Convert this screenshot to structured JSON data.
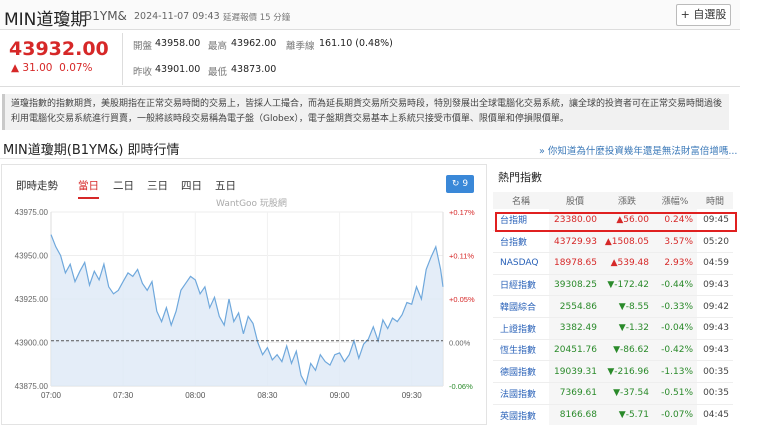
{
  "header": {
    "name": "MIN道瓊期",
    "code": "B1YM&",
    "datetime": "2024-11-07 09:43",
    "delay": "延遲報價 15 分鐘",
    "fav_button": "+ 自選股"
  },
  "quote": {
    "price": "43932.00",
    "change": "31.00",
    "change_pct": "0.07%",
    "open_label": "開盤",
    "open": "43958.00",
    "high_label": "最高",
    "high": "43962.00",
    "ma_label": "離季線",
    "ma": "161.10 (0.48%)",
    "prev_label": "昨收",
    "prev": "43901.00",
    "low_label": "最低",
    "low": "43873.00",
    "up_color": "#d62828"
  },
  "description": "道瓊指數的指數期貨，美股期指在正常交易時間的交易上，皆採人工撮合，而為延長期貨交易所交易時段，特別發展出全球電腦化交易系統，讓全球的投資者可在正常交易時間過後利用電腦化交易系統進行買賣，一般將該時段交易稱為電子盤（Globex），電子盤期貨交易基本上系統只接受市價單、限價單和停損限價單。",
  "section": {
    "title": "MIN道瓊期(B1YM&) 即時行情",
    "promo_link": "» 你知道為什麼投資幾年還是無法財富倍增嗎..."
  },
  "chart_panel": {
    "label": "即時走勢",
    "tabs": [
      "當日",
      "二日",
      "三日",
      "四日",
      "五日"
    ],
    "active_tab": "當日",
    "refresh_label": "9",
    "watermark": "WantGoo 玩股網"
  },
  "chart_data": {
    "type": "line",
    "title": "",
    "xlabel": "",
    "ylabel": "",
    "x_ticks": [
      "07:00",
      "07:30",
      "08:00",
      "08:30",
      "09:00",
      "09:30"
    ],
    "y_ticks": [
      "43975.00",
      "43950.00",
      "43925.00",
      "43900.00",
      "43875.00"
    ],
    "y_tick_values": [
      43975,
      43950,
      43925,
      43900,
      43875
    ],
    "y2_ticks": [
      "+0.17%",
      "+0.11%",
      "+0.05%",
      "0.00%",
      "-0.06%"
    ],
    "ylim": [
      43875,
      43975
    ],
    "xlim": [
      "07:00",
      "09:43"
    ],
    "reference_value": 43901,
    "line_color": "#6fa8dc",
    "fill_color": "#dde9f6",
    "series": [
      {
        "x": [
          "07:00",
          "07:02",
          "07:04",
          "07:06",
          "07:08",
          "07:10",
          "07:12",
          "07:14",
          "07:16",
          "07:18",
          "07:20",
          "07:22",
          "07:24",
          "07:26",
          "07:28",
          "07:30",
          "07:32",
          "07:34",
          "07:36",
          "07:38",
          "07:40",
          "07:42",
          "07:44",
          "07:46",
          "07:48",
          "07:50",
          "07:52",
          "07:54",
          "07:56",
          "07:58",
          "08:00",
          "08:02",
          "08:04",
          "08:06",
          "08:08",
          "08:10",
          "08:12",
          "08:14",
          "08:16",
          "08:18",
          "08:20",
          "08:22",
          "08:24",
          "08:26",
          "08:28",
          "08:30",
          "08:32",
          "08:34",
          "08:36",
          "08:38",
          "08:40",
          "08:42",
          "08:44",
          "08:46",
          "08:48",
          "08:50",
          "08:52",
          "08:54",
          "08:56",
          "08:58",
          "09:00",
          "09:02",
          "09:04",
          "09:06",
          "09:08",
          "09:10",
          "09:12",
          "09:14",
          "09:16",
          "09:18",
          "09:20",
          "09:22",
          "09:24",
          "09:26",
          "09:28",
          "09:30",
          "09:32",
          "09:34",
          "09:36",
          "09:38",
          "09:40",
          "09:42",
          "09:43"
        ],
        "y": [
          43962,
          43955,
          43950,
          43940,
          43945,
          43935,
          43941,
          43946,
          43933,
          43941,
          43936,
          43945,
          43932,
          43928,
          43930,
          43935,
          43940,
          43938,
          43942,
          43934,
          43930,
          43935,
          43918,
          43912,
          43920,
          43910,
          43918,
          43930,
          43934,
          43938,
          43936,
          43928,
          43932,
          43920,
          43926,
          43915,
          43910,
          43925,
          43912,
          43917,
          43905,
          43915,
          43911,
          43900,
          43893,
          43897,
          43890,
          43893,
          43889,
          43898,
          43888,
          43895,
          43881,
          43876,
          43888,
          43884,
          43893,
          43889,
          43887,
          43893,
          43894,
          43889,
          43893,
          43901,
          43891,
          43899,
          43902,
          43909,
          43901,
          43913,
          43908,
          43914,
          43912,
          43916,
          43923,
          43922,
          43932,
          43925,
          43942,
          43949,
          43955,
          43942,
          43932
        ]
      }
    ]
  },
  "hot": {
    "title": "熱門指數",
    "headers": [
      "名稱",
      "股價",
      "漲跌",
      "漲幅%",
      "時間"
    ],
    "rows": [
      {
        "name": "台指期",
        "price": "23380.00",
        "chg": "▲56.00",
        "pct": "0.24%",
        "time": "09:45",
        "dir": "up"
      },
      {
        "name": "台指數",
        "price": "43729.93",
        "chg": "▲1508.05",
        "pct": "3.57%",
        "time": "05:20",
        "dir": "up"
      },
      {
        "name": "NASDAQ",
        "price": "18978.65",
        "chg": "▲539.48",
        "pct": "2.93%",
        "time": "04:59",
        "dir": "up"
      },
      {
        "name": "日經指數",
        "price": "39308.25",
        "chg": "▼-172.42",
        "pct": "-0.44%",
        "time": "09:43",
        "dir": "down"
      },
      {
        "name": "韓國綜合",
        "price": "2554.86",
        "chg": "▼-8.55",
        "pct": "-0.33%",
        "time": "09:42",
        "dir": "down"
      },
      {
        "name": "上證指數",
        "price": "3382.49",
        "chg": "▼-1.32",
        "pct": "-0.04%",
        "time": "09:43",
        "dir": "down"
      },
      {
        "name": "恆生指數",
        "price": "20451.76",
        "chg": "▼-86.62",
        "pct": "-0.42%",
        "time": "09:43",
        "dir": "down"
      },
      {
        "name": "德國指數",
        "price": "19039.31",
        "chg": "▼-216.96",
        "pct": "-1.13%",
        "time": "00:35",
        "dir": "down"
      },
      {
        "name": "法國指數",
        "price": "7369.61",
        "chg": "▼-37.54",
        "pct": "-0.51%",
        "time": "00:35",
        "dir": "down"
      },
      {
        "name": "英國指數",
        "price": "8166.68",
        "chg": "▼-5.71",
        "pct": "-0.07%",
        "time": "04:45",
        "dir": "down"
      }
    ],
    "up_color": "#d62828",
    "down_color": "#2a8a2a",
    "highlight_color": "#e02020"
  }
}
